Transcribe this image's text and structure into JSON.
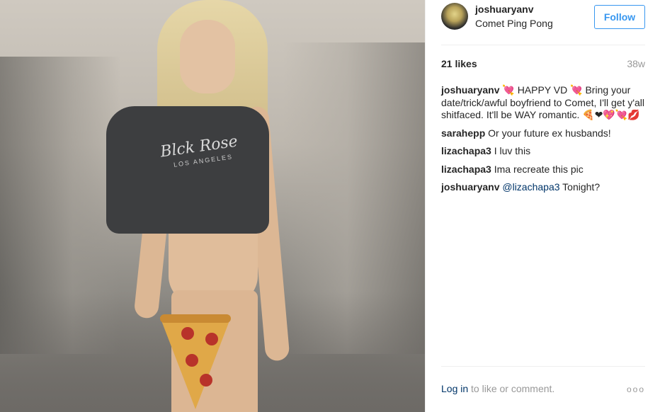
{
  "post": {
    "username": "joshuaryanv",
    "location": "Comet Ping Pong",
    "follow_label": "Follow",
    "likes": "21 likes",
    "age": "38w",
    "caption": {
      "user": "joshuaryanv",
      "text": "💘 HAPPY VD 💘 Bring your date/trick/awful boyfriend to Comet, I'll get y'all shitfaced. It'll be WAY romantic. 🍕❤💖💘💋"
    },
    "comments": [
      {
        "user": "sarahepp",
        "text": "Or your future ex husbands!"
      },
      {
        "user": "lizachapa3",
        "text": "I luv this"
      },
      {
        "user": "lizachapa3",
        "text": "Ima recreate this pic"
      },
      {
        "user": "joshuaryanv",
        "mention": "@lizachapa3",
        "text": " Tonight?"
      }
    ],
    "footer": {
      "login_label": "Log in",
      "rest_text": " to like or comment.",
      "more_label": "ooo"
    }
  },
  "photo": {
    "shirt_text": "Blck Rose",
    "shirt_subtext": "LOS ANGELES"
  },
  "colors": {
    "accent": "#3897f0",
    "link": "#003569",
    "muted": "#999999"
  }
}
